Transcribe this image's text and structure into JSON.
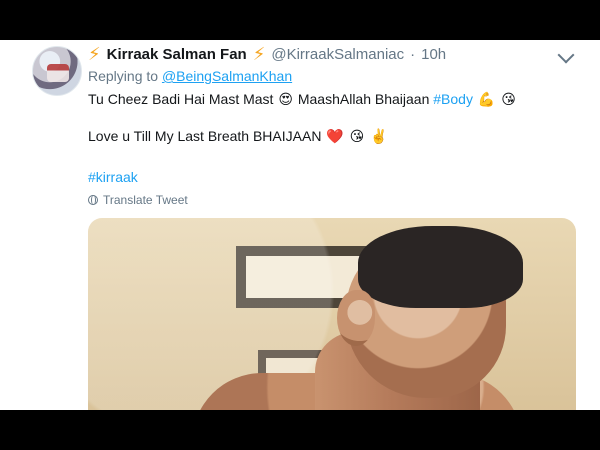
{
  "tweet": {
    "author_name": "Kirraak Salman Fan",
    "author_handle": "@KirraakSalmaniac",
    "time": "10h",
    "replying_prefix": "Replying to",
    "replying_user": "@BeingSalmanKhan",
    "text_line_1": "Tu Cheez Badi Hai Mast Mast",
    "text_line_1_suffix": "MaashAllah Bhaijaan",
    "hashtag_body": "#Body",
    "text_line_2": "Love u Till My Last Breath BHAIJAAN",
    "hashtag_2": "#kirraak",
    "translate_label": "Translate Tweet",
    "icons": {
      "bolt": "lightning-bolt",
      "more": "chevron-down-icon",
      "globe": "globe-icon",
      "heart_eyes": "heart-eyes-emoji",
      "kiss": "kiss-emoji",
      "flex": "flexed-biceps-emoji",
      "heart": "red-heart-emoji",
      "victory": "victory-hand-emoji"
    }
  }
}
